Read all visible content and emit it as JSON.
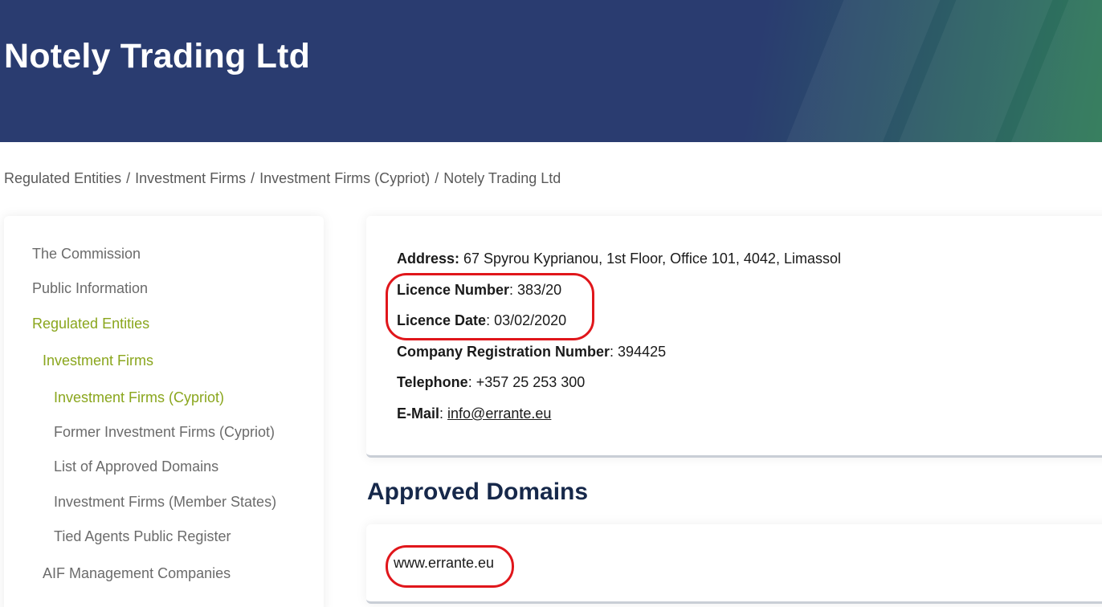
{
  "header": {
    "title": "Notely Trading Ltd"
  },
  "breadcrumb": [
    "Regulated Entities",
    "Investment Firms",
    "Investment Firms (Cypriot)",
    "Notely Trading Ltd"
  ],
  "breadcrumb_separator": "/",
  "sidebar": {
    "items": [
      {
        "label": "The Commission",
        "active": false
      },
      {
        "label": "Public Information",
        "active": false
      },
      {
        "label": "Regulated Entities",
        "active": true
      },
      {
        "label": "Investment Firms",
        "active": true
      },
      {
        "label": "Investment Firms (Cypriot)",
        "active": true
      },
      {
        "label": "Former Investment Firms (Cypriot)",
        "active": false
      },
      {
        "label": "List of Approved Domains",
        "active": false
      },
      {
        "label": "Investment Firms (Member States)",
        "active": false
      },
      {
        "label": "Tied Agents Public Register",
        "active": false
      },
      {
        "label": "AIF Management Companies",
        "active": false
      }
    ]
  },
  "details": {
    "address": {
      "label": "Address:",
      "value": " 67 Spyrou Kyprianou, 1st Floor, Office 101, 4042, Limassol"
    },
    "licence_number": {
      "label": "Licence Number",
      "value": ": 383/20"
    },
    "licence_date": {
      "label": "Licence Date",
      "value": ": 03/02/2020"
    },
    "company_registration": {
      "label": "Company Registration Number",
      "value": ": 394425"
    },
    "telephone": {
      "label": "Telephone",
      "value": ": +357 25 253 300"
    },
    "email": {
      "label": "E-Mail",
      "colon": ": ",
      "value": "info@errante.eu"
    }
  },
  "approved_domains": {
    "title": "Approved Domains",
    "items": [
      "www.errante.eu"
    ]
  },
  "colors": {
    "banner": "#2a3c70",
    "active_nav": "#8aa61d",
    "highlight": "#e0161b",
    "section_title": "#16284a"
  }
}
